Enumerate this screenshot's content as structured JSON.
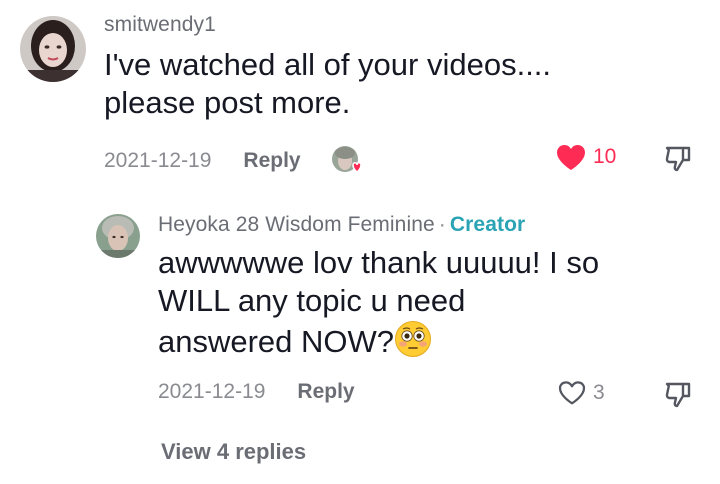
{
  "comments": [
    {
      "username": "smitwendy1",
      "text_line1": "I've watched all of your videos....",
      "text_line2": "please post more.",
      "date": "2021-12-19",
      "reply_label": "Reply",
      "like_count": "10",
      "liked": true
    }
  ],
  "reply": {
    "username": "Heyoka 28 Wisdom Feminine",
    "separator": "·",
    "creator_label": "Creator",
    "text_line1": "awwwwwe lov thank uuuuu! I so",
    "text_line2": "WILL any topic u need",
    "text_line3": "answered NOW?",
    "emoji_name": "flushed-face-emoji",
    "date": "2021-12-19",
    "reply_label": "Reply",
    "like_count": "3",
    "liked": false
  },
  "view_replies_label": "View 4 replies",
  "colors": {
    "accent_like": "#fe2c55",
    "creator": "#2aa4b5",
    "text_primary": "#161823",
    "text_secondary": "#8a8b91"
  }
}
